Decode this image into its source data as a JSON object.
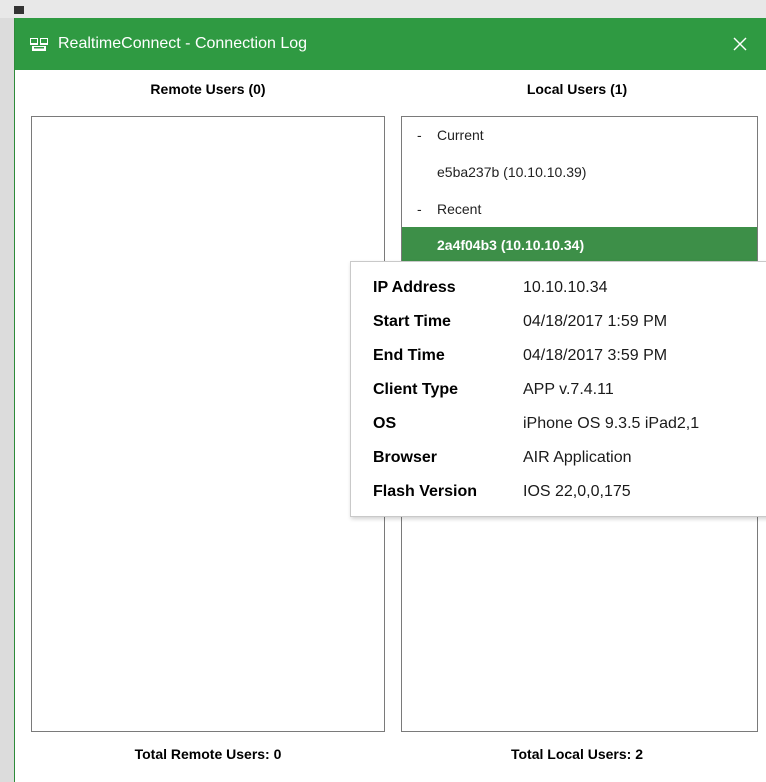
{
  "window": {
    "title": "RealtimeConnect - Connection Log",
    "close_glyph": "✕",
    "icon": "realtimeconnect-app-icon",
    "accent_color": "#2f9a42"
  },
  "remote": {
    "header": "Remote Users (0)",
    "items": [],
    "footer": "Total Remote Users: 0"
  },
  "local": {
    "header": "Local Users (1)",
    "items": [
      {
        "prefix": "-",
        "label": "Current",
        "type": "group"
      },
      {
        "label": "e5ba237b (10.10.10.39)",
        "type": "user"
      },
      {
        "prefix": "-",
        "label": "Recent",
        "type": "group"
      },
      {
        "label": "2a4f04b3 (10.10.10.34)",
        "type": "user",
        "selected": true
      }
    ],
    "footer": "Total Local Users: 2",
    "selected_color": "#3d8f48"
  },
  "tooltip": {
    "rows": [
      {
        "label": "IP Address",
        "value": "10.10.10.34"
      },
      {
        "label": "Start Time",
        "value": "04/18/2017 1:59 PM"
      },
      {
        "label": "End Time",
        "value": "04/18/2017 3:59 PM"
      },
      {
        "label": "Client Type",
        "value": "APP v.7.4.11"
      },
      {
        "label": "OS",
        "value": "iPhone OS 9.3.5 iPad2,1"
      },
      {
        "label": "Browser",
        "value": "AIR Application"
      },
      {
        "label": "Flash Version",
        "value": "IOS 22,0,0,175"
      }
    ]
  }
}
